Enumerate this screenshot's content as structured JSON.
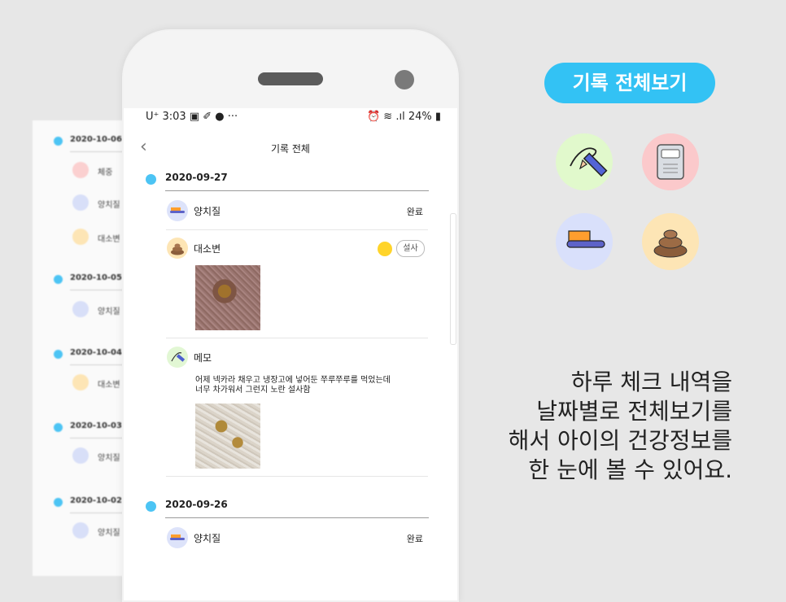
{
  "background_list": {
    "dates": [
      "2020-10-06",
      "2020-10-05",
      "2020-10-04",
      "2020-10-03",
      "2020-10-02"
    ],
    "items": [
      "체중",
      "양치질",
      "대소변",
      "양치질",
      "대소변",
      "양치질",
      "양치질"
    ]
  },
  "statusbar": {
    "left": "U⁺ 3:03 ▣ ✐ ● ···",
    "right": "⏰ ≋ .ıl 24% ▮"
  },
  "appbar": {
    "back_icon": "chevron-left-icon",
    "title": "기록 전체"
  },
  "timeline": [
    {
      "date": "2020-09-27",
      "entries": [
        {
          "icon": "toothbrush-icon",
          "label": "양치질",
          "status": "완료"
        },
        {
          "icon": "poop-icon",
          "label": "대소변",
          "badge": "설사",
          "badge_dot_color": "#ffd42a"
        },
        {
          "icon": "memo-icon",
          "label": "메모",
          "text": "어제 넥카라 채우고 냉장고에 넣어둔 쭈루쭈루를 먹었는데\n너무 차가워서 그런지 노란 설사함"
        }
      ]
    },
    {
      "date": "2020-09-26",
      "entries": [
        {
          "icon": "toothbrush-icon",
          "label": "양치질",
          "status": "완료"
        }
      ]
    }
  ],
  "promo": {
    "pill": "기록 전체보기",
    "icons": [
      "pencil-memo-icon",
      "scale-icon",
      "toothbrush-icon",
      "poop-icon"
    ],
    "tagline": "하루 체크 내역을\n날짜별로 전체보기를\n해서 아이의 건강정보를\n한 눈에 볼 수 있어요."
  },
  "colors": {
    "accent": "#33c2f4",
    "dot": "#4cc4f4",
    "loose_stool": "#ffd42a"
  }
}
